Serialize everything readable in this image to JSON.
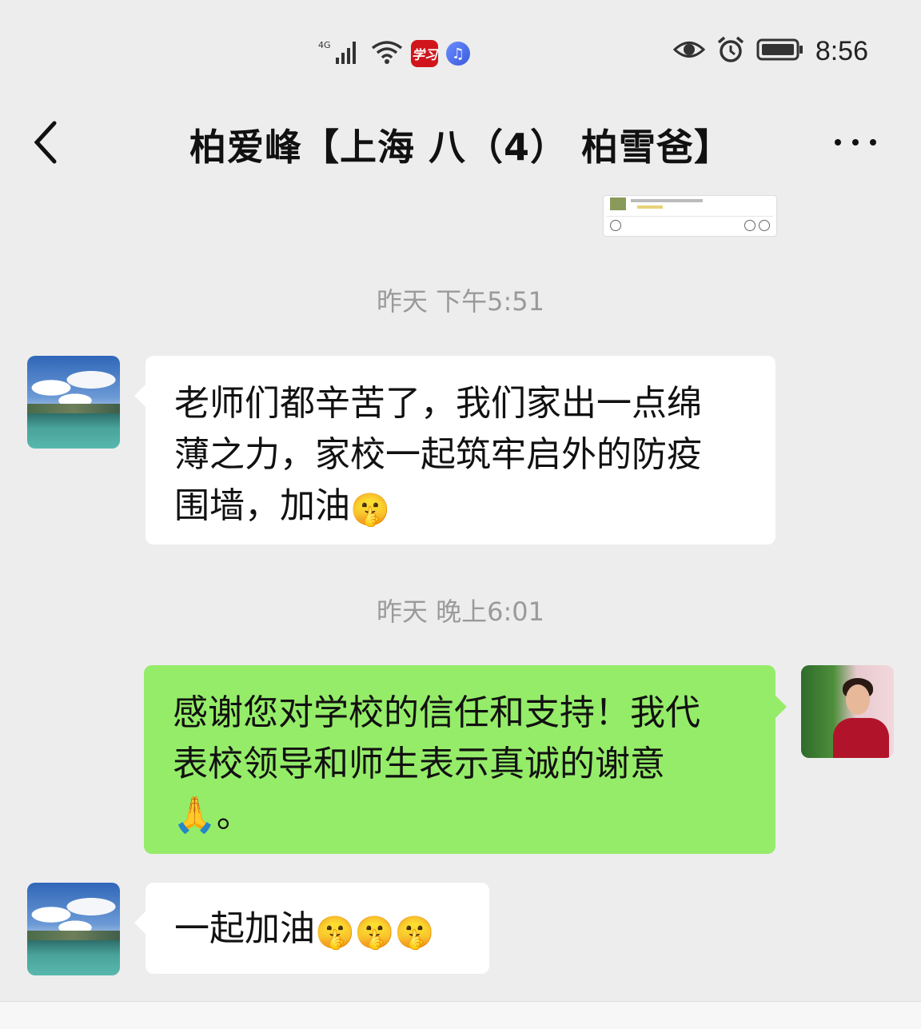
{
  "status_bar": {
    "network": "4G",
    "app_badge": "学习",
    "time": "8:56",
    "icons": [
      "signal-icon",
      "wifi-icon",
      "study-app-icon",
      "music-icon",
      "eye-icon",
      "alarm-icon",
      "battery-icon"
    ]
  },
  "header": {
    "title": "柏爱峰【上海 八（4） 柏雪爸】",
    "back_icon": "chevron-left-icon",
    "more_icon": "more-dots-icon"
  },
  "messages": [
    {
      "timestamp": "昨天 下午5:51",
      "sender": "contact",
      "text": "老师们都辛苦了，我们家出一点绵薄之力，家校一起筑牢启外的防疫围墙，加油",
      "lines": [
        "老师们都辛苦了，我们家出一点绵",
        "薄之力，家校一起筑牢启外的防疫",
        "围墙，加油"
      ],
      "emoji": [
        "🤫"
      ]
    },
    {
      "timestamp": "昨天 晚上6:01",
      "sender": "me",
      "text": "感谢您对学校的信任和支持！我代表校领导和师生表示真诚的谢意🙏。",
      "lines": [
        "感谢您对学校的信任和支持！我代",
        "表校领导和师生表示真诚的谢意",
        "🙏。"
      ]
    },
    {
      "sender": "contact",
      "text": "一起加油",
      "emoji": [
        "🤫",
        "🤫",
        "🤫"
      ]
    }
  ],
  "colors": {
    "background": "#ededed",
    "bubble_in": "#ffffff",
    "bubble_out": "#95ec69",
    "timestamp": "#9a9a9a"
  }
}
